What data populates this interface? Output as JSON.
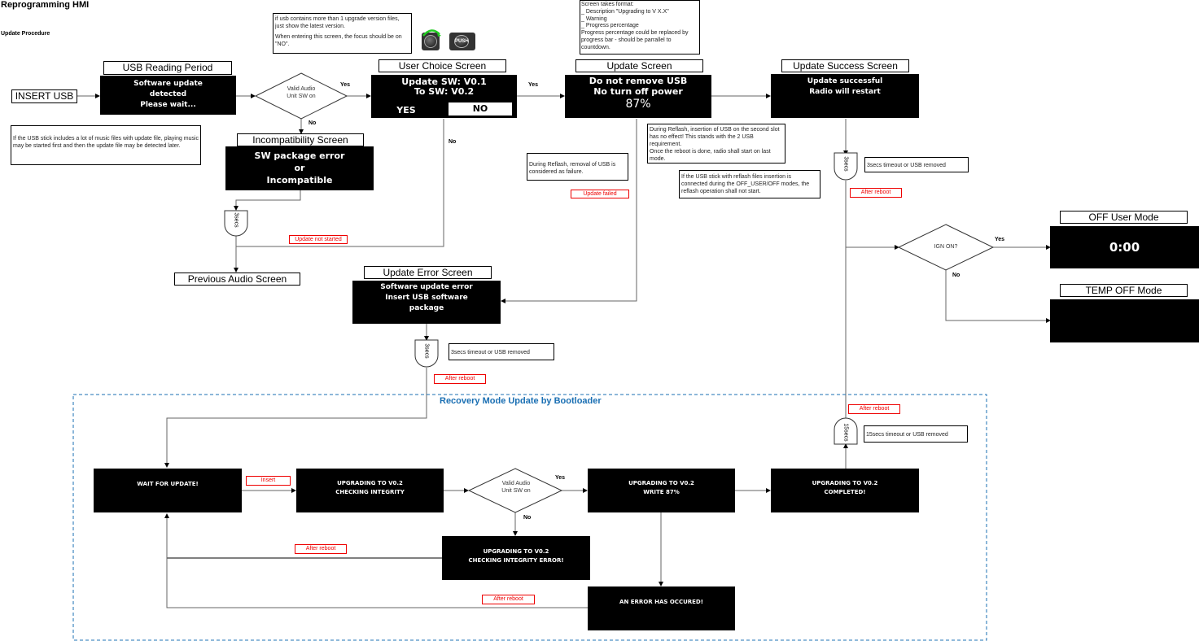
{
  "header": {
    "title": "Reprogramming HMI",
    "subtitle": "Update Procedure"
  },
  "start": {
    "label": "INSERT USB"
  },
  "screens": {
    "usb_reading": {
      "label": "USB Reading Period",
      "lines": [
        "Software update",
        "detected",
        "Please wait..."
      ]
    },
    "incompatibility": {
      "label": "Incompatibility Screen",
      "lines": [
        "SW package error",
        "or",
        "Incompatible"
      ]
    },
    "previous_audio": {
      "label": "Previous Audio Screen"
    },
    "user_choice": {
      "label": "User Choice Screen",
      "line1": "Update SW: V0.1",
      "line2": "To SW: V0.2",
      "yes": "YES",
      "no": "NO"
    },
    "update": {
      "label": "Update Screen",
      "line1": "Do not remove USB",
      "line2": "No turn off power",
      "progress": "87%"
    },
    "update_success": {
      "label": "Update Success Screen",
      "line1": "Update successful",
      "line2": "Radio will restart"
    },
    "update_error": {
      "label": "Update Error Screen",
      "lines": [
        "Software update error",
        "Insert USB software",
        "package"
      ]
    },
    "off_user": {
      "label": "OFF User Mode",
      "clock": "0:00"
    },
    "temp_off": {
      "label": "TEMP OFF Mode"
    }
  },
  "decisions": {
    "valid_audio_top": {
      "text": [
        "Valid Audio",
        "Unit SW on"
      ],
      "yes": "Yes",
      "no": "No"
    },
    "ign_on": {
      "text": "IGN ON?",
      "yes": "Yes",
      "no": "No"
    },
    "valid_audio_recovery": {
      "text": [
        "Valid Audio",
        "Unit SW on"
      ],
      "yes": "Yes",
      "no": "No"
    }
  },
  "edge_labels": {
    "user_choice_yes": "Yes",
    "user_choice_no": "No"
  },
  "timers": {
    "incompat": "3secs",
    "success": "3secs",
    "error": "3secs",
    "completed": "15secs"
  },
  "notes": {
    "usb_music": "If the USB stick includes a lot of music files with update file, playing music may be started first and then the update file may be detected later.",
    "latest_version": [
      "if usb contains more than 1 upgrade version files, just show the latest version.",
      "When entering this screen, the focus should be on \"NO\"."
    ],
    "screen_format": [
      "Screen takes format:",
      "_ Description \"Upgrading to V X.X\"",
      "_ Warning",
      "_ Progress percentage",
      "Progress percentage could be replaced by progress bar - should be parrallel to countdown."
    ],
    "removal_failure": "During Reflash, removal of USB is considered as failure.",
    "second_slot": [
      "During Reflash, insertion of USB on the second slot has no effect! This stands with the 2 USB requirement.",
      "Once the reboot is done, radio shall start on last mode."
    ],
    "off_modes": "If the USB stick with reflash files insertion is connected during the OFF_USER/OFF modes, the reflash operation shall not start.",
    "success_timeout": "3secs timeout or USB removed",
    "error_timeout": "3secs timeout or USB removed",
    "completed_timeout": "15secs timeout or USB removed"
  },
  "tags": {
    "update_not_started": "Update not started",
    "update_failed": "Update failed",
    "after_reboot_success": "After reboot",
    "after_reboot_error": "After reboot",
    "after_reboot_completed": "After reboot",
    "insert": "Insert",
    "after_reboot_integrity": "After reboot",
    "after_reboot_error_occured": "After reboot"
  },
  "knob_icons": {
    "push_label": "PUSH"
  },
  "recovery": {
    "title": "Recovery Mode Update by Bootloader",
    "wait": "WAIT FOR UPDATE!",
    "checking": [
      "UPGRADING TO V0.2",
      "CHECKING INTEGRITY"
    ],
    "write": [
      "UPGRADING TO V0.2",
      "WRITE 87%"
    ],
    "completed": [
      "UPGRADING TO V0.2",
      "COMPLETED!"
    ],
    "integrity_error": [
      "UPGRADING TO V0.2",
      "CHECKING INTEGRITY ERROR!"
    ],
    "error_occured": "AN ERROR HAS OCCURED!"
  },
  "colors": {
    "tag_red": "#e00000",
    "recovery_blue": "#1a6fb3",
    "wire": "#555555"
  }
}
